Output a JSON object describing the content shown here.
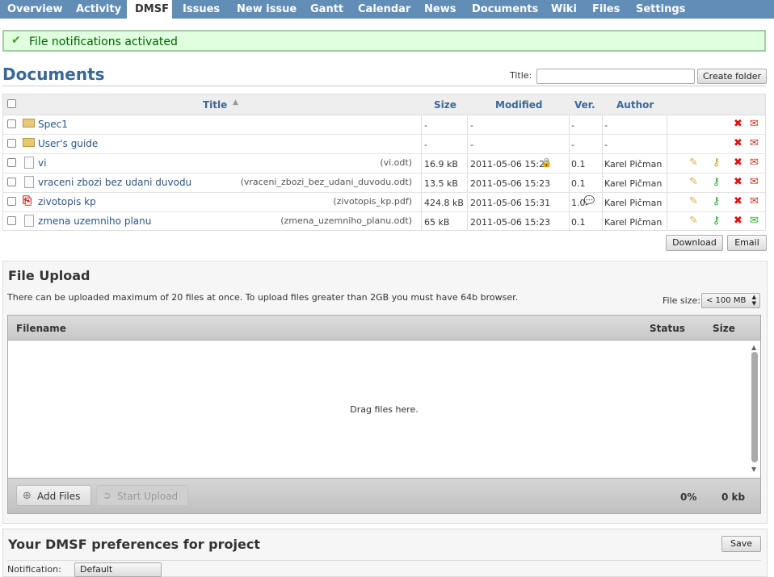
{
  "nav": {
    "tabs": [
      "Overview",
      "Activity",
      "DMSF",
      "Issues",
      "New issue",
      "Gantt",
      "Calendar",
      "News",
      "Documents",
      "Wiki",
      "Files",
      "Settings"
    ],
    "selected": "DMSF"
  },
  "flash": {
    "message": "File notifications activated"
  },
  "documents": {
    "heading": "Documents",
    "title_label": "Title:",
    "title_value": "",
    "create_folder": "Create folder",
    "columns": {
      "title": "Title",
      "size": "Size",
      "modified": "Modified",
      "ver": "Ver.",
      "author": "Author"
    },
    "rows": [
      {
        "name": "Spec1",
        "type": "folder",
        "filename": "",
        "size": "-",
        "modified": "-",
        "ver": "-",
        "author": "-"
      },
      {
        "name": "User's guide",
        "type": "folder",
        "filename": "",
        "size": "-",
        "modified": "-",
        "ver": "-",
        "author": "-"
      },
      {
        "name": "vi",
        "type": "file",
        "filename": "(vi.odt)",
        "size": "16.9 kB",
        "modified": "2011-05-06 15:23",
        "ver": "0.1",
        "author": "Karel Pičman"
      },
      {
        "name": "vraceni zbozi bez udani duvodu",
        "type": "file",
        "filename": "(vraceni_zbozi_bez_udani_duvodu.odt)",
        "size": "13.5 kB",
        "modified": "2011-05-06 15:23",
        "ver": "0.1",
        "author": "Karel Pičman"
      },
      {
        "name": "zivotopis kp",
        "type": "pdf",
        "filename": "(zivotopis_kp.pdf)",
        "size": "424.8 kB",
        "modified": "2011-05-06 15:31",
        "ver": "1.0",
        "author": "Karel Pičman"
      },
      {
        "name": "zmena uzemniho planu",
        "type": "file",
        "filename": "(zmena_uzemniho_planu.odt)",
        "size": "65 kB",
        "modified": "2011-05-06 15:23",
        "ver": "0.1",
        "author": "Karel Pičman"
      }
    ],
    "download": "Download",
    "email": "Email"
  },
  "upload": {
    "heading": "File Upload",
    "note": "There can be uploaded maximum of 20 files at once. To upload files greater than 2GB you must have 64b browser.",
    "filesize_label": "File size:",
    "filesize_value": "< 100 MB",
    "col_filename": "Filename",
    "col_status": "Status",
    "col_size": "Size",
    "drop_text": "Drag files here.",
    "add_files": "Add Files",
    "start_upload": "Start Upload",
    "percent": "0%",
    "total": "0 kb"
  },
  "prefs": {
    "heading": "Your DMSF preferences for project",
    "save": "Save",
    "notify_label": "Notification:",
    "notify_value": "Default"
  }
}
